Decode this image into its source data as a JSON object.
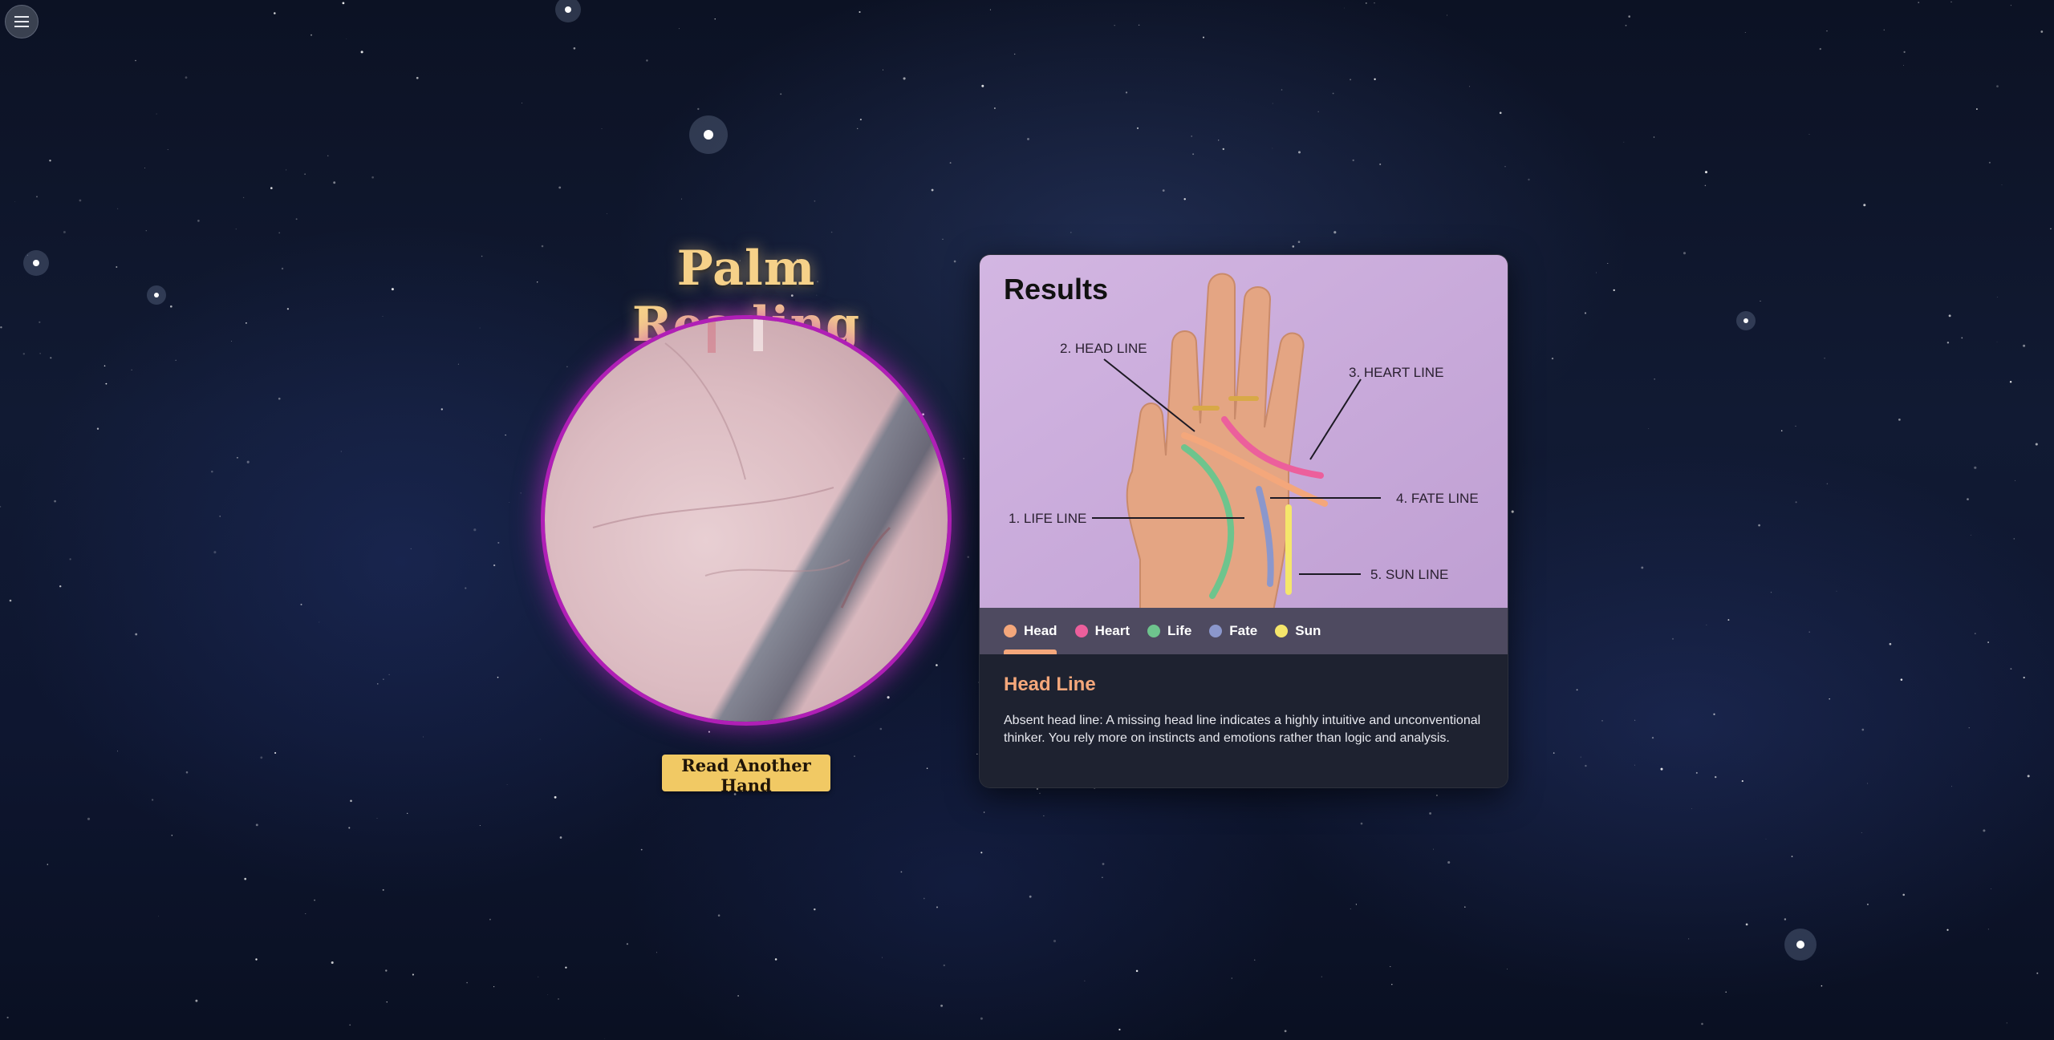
{
  "app": {
    "title": "Palm Reading",
    "menu_icon": "hamburger-icon",
    "read_another_label": "Read Another Hand"
  },
  "results": {
    "title": "Results",
    "diagram_labels": {
      "head": "2. HEAD LINE",
      "heart": "3. HEART LINE",
      "life": "1. LIFE LINE",
      "fate": "4. FATE LINE",
      "sun": "5. SUN LINE"
    },
    "legend": [
      {
        "label": "Head",
        "color": "#f4a77b"
      },
      {
        "label": "Heart",
        "color": "#ec5f9c"
      },
      {
        "label": "Life",
        "color": "#6ec48d"
      },
      {
        "label": "Fate",
        "color": "#8b97cc"
      },
      {
        "label": "Sun",
        "color": "#f5e66b"
      }
    ],
    "selected": {
      "title": "Head Line",
      "color": "#f4a77b",
      "text": "Absent head line: A missing head line indicates a highly intuitive and unconventional thinker. You rely more on instincts and emotions rather than logic and analysis."
    }
  },
  "colors": {
    "accent_gold": "#f6d189",
    "button_gold": "#f1c964",
    "glow_magenta": "#b01fb6",
    "card_bg": "#1e2230",
    "diagram_bg": "#cfb1dd"
  }
}
